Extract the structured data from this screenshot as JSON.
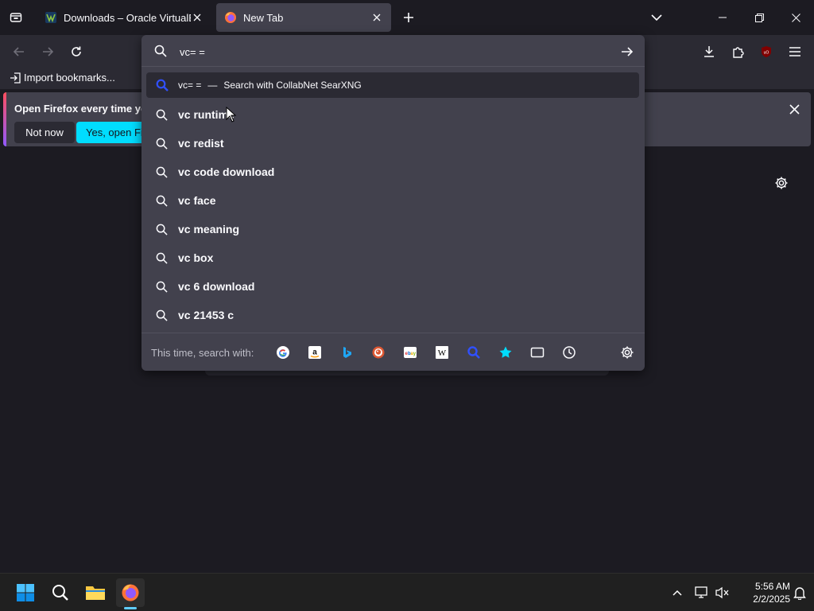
{
  "colors": {
    "accent": "#00ddff",
    "toolbar": "#2b2a33",
    "background": "#1c1b22",
    "popup": "#42414d"
  },
  "tabs": [
    {
      "title": "Downloads – Oracle VirtualBox",
      "icon": "virtualbox-icon",
      "active": false
    },
    {
      "title": "New Tab",
      "icon": "firefox-icon",
      "active": true
    }
  ],
  "bookmarks": {
    "import_label": "Import bookmarks..."
  },
  "notification": {
    "message": "Open Firefox every time you",
    "not_now": "Not now",
    "yes_button": "Yes, open Fire"
  },
  "urlbar": {
    "value": "vc= =",
    "selected_result": {
      "query": "vc= =",
      "separator": "—",
      "action": "Search with CollabNet SearXNG"
    },
    "suggestions": [
      "vc runtime",
      "vc redist",
      "vc code download",
      "vc face",
      "vc meaning",
      "vc box",
      "vc 6 download",
      "vc 21453 c"
    ],
    "oneoff_label": "This time, search with:",
    "engines": [
      "google-icon",
      "amazon-icon",
      "bing-icon",
      "duckduckgo-icon",
      "ebay-icon",
      "wikipedia-icon",
      "searxng-icon",
      "bookmarks-icon",
      "tabs-icon",
      "history-icon"
    ]
  },
  "taskbar": {
    "time": "5:56 AM",
    "date": "2/2/2025"
  }
}
